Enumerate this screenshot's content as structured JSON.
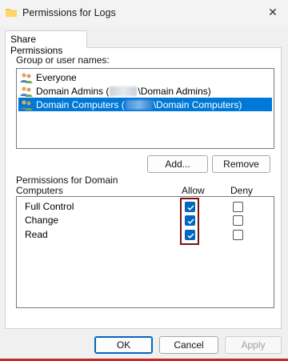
{
  "window": {
    "title": "Permissions for Logs",
    "close_glyph": "✕"
  },
  "tab": {
    "label": "Share Permissions"
  },
  "users": {
    "group_label": "Group or user names:",
    "items": [
      {
        "pre": "Everyone",
        "post": "",
        "redacted": false,
        "selected": false
      },
      {
        "pre": "Domain Admins (",
        "post": "\\Domain Admins)",
        "redacted": true,
        "selected": false
      },
      {
        "pre": "Domain Computers (",
        "post": "\\Domain Computers)",
        "redacted": true,
        "selected": true
      }
    ]
  },
  "buttons": {
    "add": "Add...",
    "remove": "Remove",
    "ok": "OK",
    "cancel": "Cancel",
    "apply": "Apply"
  },
  "permissions": {
    "label_line1": "Permissions for Domain",
    "label_line2": "Computers",
    "allow_header": "Allow",
    "deny_header": "Deny",
    "rows": [
      {
        "name": "Full Control",
        "allow": true,
        "deny": false
      },
      {
        "name": "Change",
        "allow": true,
        "deny": false
      },
      {
        "name": "Read",
        "allow": true,
        "deny": false
      }
    ]
  },
  "colors": {
    "selection": "#0078d7",
    "checkbox_accent": "#0067c0",
    "highlight_border": "#7b1111"
  }
}
